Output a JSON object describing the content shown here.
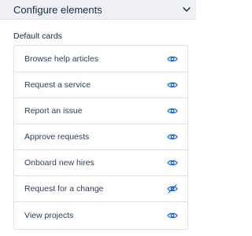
{
  "header": {
    "title": "Configure elements",
    "toggle_icon": "chevron-down-icon"
  },
  "section": {
    "label": "Default cards"
  },
  "cards": [
    {
      "label": "Browse help articles",
      "visibility_icon": "eye-icon",
      "visible": true
    },
    {
      "label": "Request a service",
      "visibility_icon": "eye-icon",
      "visible": true
    },
    {
      "label": "Report an issue",
      "visibility_icon": "eye-icon",
      "visible": true
    },
    {
      "label": "Approve requests",
      "visibility_icon": "eye-icon",
      "visible": true
    },
    {
      "label": "Onboard new hires",
      "visibility_icon": "eye-icon",
      "visible": true
    },
    {
      "label": "Request for a change",
      "visibility_icon": "eye-off-icon",
      "visible": false
    },
    {
      "label": "View projects",
      "visibility_icon": "eye-icon",
      "visible": true
    }
  ],
  "colors": {
    "accent": "#0c66e4",
    "header_bg": "#eef0f3",
    "border": "#dfe1e6",
    "text": "#172b4d"
  }
}
